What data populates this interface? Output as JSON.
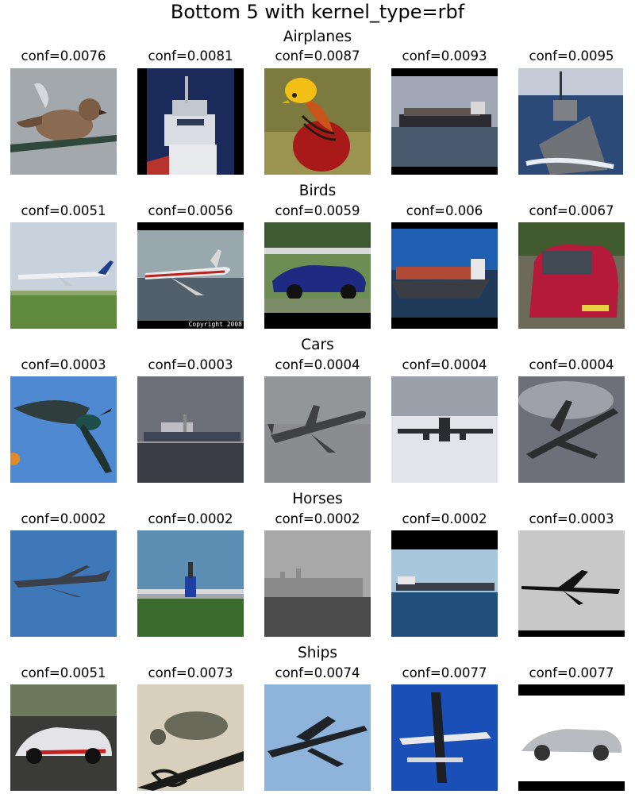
{
  "figure": {
    "title": "Bottom 5 with kernel_type=rbf"
  },
  "rows": [
    {
      "name": "Airplanes",
      "items": [
        {
          "conf": "conf=0.0076",
          "icon": "sparrow-on-bar-icon"
        },
        {
          "conf": "conf=0.0081",
          "icon": "ship-superstructure-icon"
        },
        {
          "conf": "conf=0.0087",
          "icon": "golden-pheasant-icon"
        },
        {
          "conf": "conf=0.0093",
          "icon": "cargo-ship-icon"
        },
        {
          "conf": "conf=0.0095",
          "icon": "warship-icon"
        }
      ]
    },
    {
      "name": "Birds",
      "items": [
        {
          "conf": "conf=0.0051",
          "icon": "airliner-takeoff-icon"
        },
        {
          "conf": "conf=0.0056",
          "icon": "propeller-airliner-icon",
          "caption": "Copyright 2008"
        },
        {
          "conf": "conf=0.0059",
          "icon": "blue-sedan-icon"
        },
        {
          "conf": "conf=0.006",
          "icon": "container-ship-icon"
        },
        {
          "conf": "conf=0.0067",
          "icon": "red-hatchback-icon"
        }
      ]
    },
    {
      "name": "Cars",
      "items": [
        {
          "conf": "conf=0.0003",
          "icon": "hummingbird-icon"
        },
        {
          "conf": "conf=0.0003",
          "icon": "ship-grey-sea-icon"
        },
        {
          "conf": "conf=0.0004",
          "icon": "jumbo-jet-grey-icon"
        },
        {
          "conf": "conf=0.0004",
          "icon": "airliner-front-icon"
        },
        {
          "conf": "conf=0.0004",
          "icon": "airliner-cloudy-icon"
        }
      ]
    },
    {
      "name": "Horses",
      "items": [
        {
          "conf": "conf=0.0002",
          "icon": "bomber-blue-sky-icon"
        },
        {
          "conf": "conf=0.0002",
          "icon": "jet-on-runway-icon"
        },
        {
          "conf": "conf=0.0002",
          "icon": "ship-in-haze-icon"
        },
        {
          "conf": "conf=0.0002",
          "icon": "tanker-on-sea-icon"
        },
        {
          "conf": "conf=0.0003",
          "icon": "b1-bomber-icon"
        }
      ]
    },
    {
      "name": "Ships",
      "items": [
        {
          "conf": "conf=0.0051",
          "icon": "race-car-icon"
        },
        {
          "conf": "conf=0.0073",
          "icon": "dove-on-railing-icon"
        },
        {
          "conf": "conf=0.0074",
          "icon": "lancaster-bomber-icon"
        },
        {
          "conf": "conf=0.0077",
          "icon": "seaplane-icon"
        },
        {
          "conf": "conf=0.0077",
          "icon": "silver-convertible-icon"
        }
      ]
    }
  ]
}
